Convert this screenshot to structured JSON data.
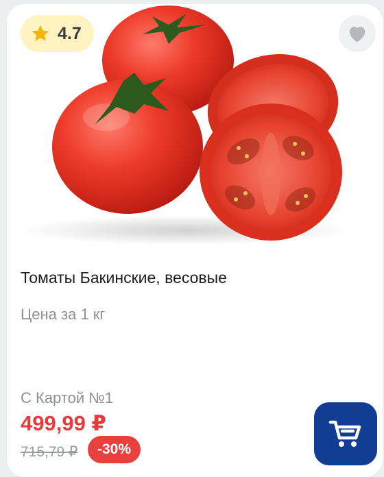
{
  "product": {
    "rating": "4.7",
    "rating_icon": "star-icon",
    "favorite_icon": "heart-icon",
    "image_subject": "tomatoes",
    "title": "Томаты Бакинские, весовые",
    "unit": "Цена за 1 кг",
    "card_price_label": "С Картой №1",
    "price": "499,99 ₽",
    "old_price": "715,79 ₽",
    "discount": "-30%",
    "cart_icon": "cart-icon"
  },
  "colors": {
    "accent_blue": "#123d94",
    "sale_red": "#e53b3b",
    "rating_bg": "#fff3c2",
    "star": "#f5b400"
  }
}
